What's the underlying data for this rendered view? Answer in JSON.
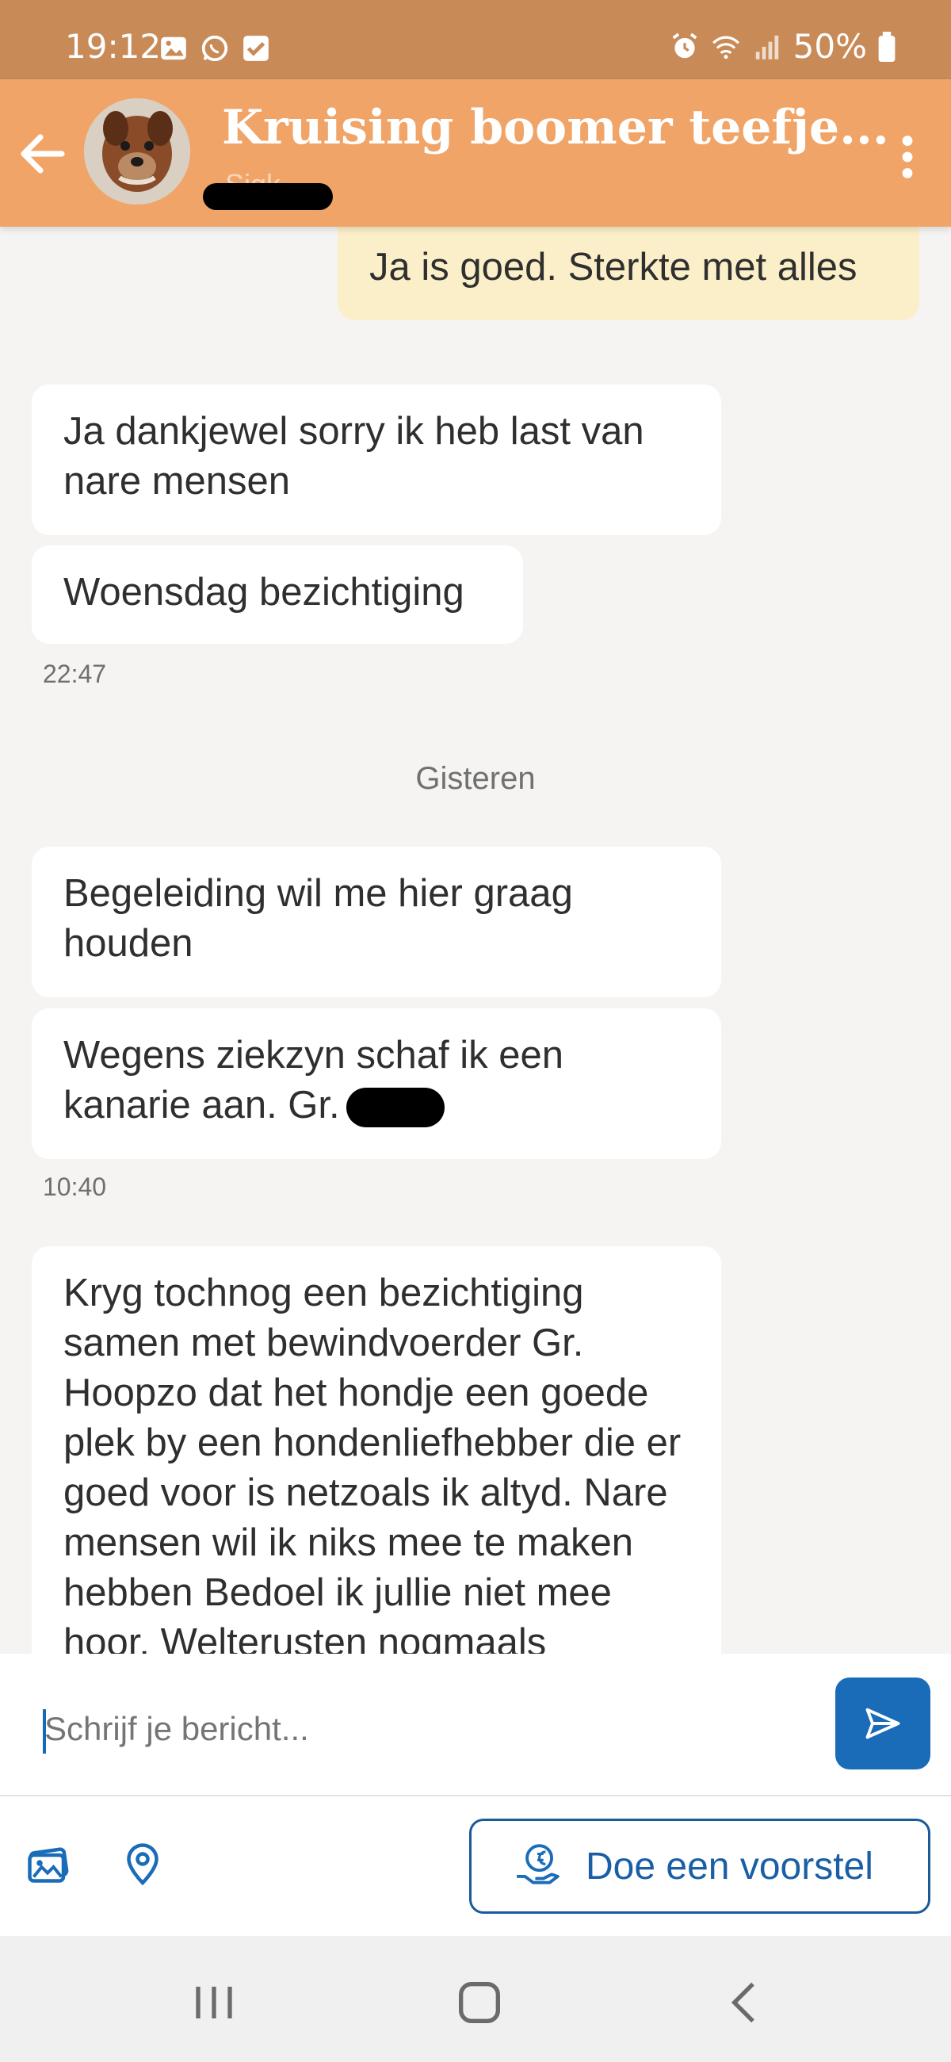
{
  "status_bar": {
    "time": "19:12",
    "battery": "50%"
  },
  "header": {
    "title": "Kruising boomer teefje...",
    "subtitle": "Sigk"
  },
  "messages": [
    {
      "text": "Ja is goed. Sterkte met alles",
      "own": true
    },
    {
      "text": "Ja dankjewel sorry ik heb last van nare mensen",
      "own": false
    },
    {
      "text": "Woensdag bezichtiging",
      "own": false
    },
    {
      "text": "Begeleiding wil me hier graag houden",
      "own": false
    },
    {
      "text": "Wegens ziekzyn schaf ik een kanarie aan. Gr.",
      "own": false
    },
    {
      "text": "Kryg tochnog een bezichtiging samen met bewindvoerder Gr. Hoopzo dat het hondje een goede plek by een hondenliefhebber die er goed voor is netzoals ik altyd. Nare mensen wil ik niks mee te maken hebben Bedoel ik jullie niet mee hoor. Welterusten nogmaals",
      "own": false
    }
  ],
  "timestamps": {
    "first": "22:47",
    "second": "10:40"
  },
  "day_separator": "Gisteren",
  "composer": {
    "placeholder": "Schrijf je bericht..."
  },
  "actions": {
    "offer_label": "Doe een voorstel"
  },
  "icons": {
    "back": "arrow-left-icon",
    "menu": "more-vertical-icon",
    "send": "send-icon",
    "gallery": "image-gallery-icon",
    "location": "location-pin-icon",
    "offer": "euro-hand-icon"
  },
  "colors": {
    "status_bar": "#c88a57",
    "header": "#f0a468",
    "own_bubble": "#fbefc9",
    "accent_blue": "#1a6cb9"
  }
}
